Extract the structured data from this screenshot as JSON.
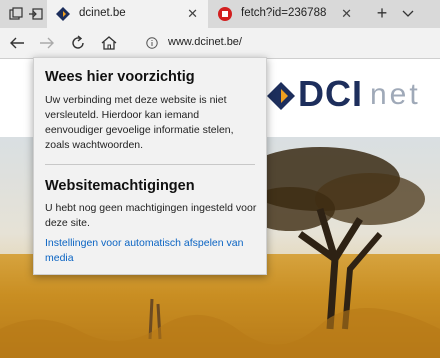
{
  "tabs": [
    {
      "title": "dcinet.be",
      "close_icon": "close-icon"
    },
    {
      "title": "fetch?id=236788",
      "close_icon": "close-icon"
    }
  ],
  "tabbar": {
    "new_tab_label": "+"
  },
  "address": {
    "url": "www.dcinet.be/"
  },
  "site": {
    "logo_main": "DCI",
    "logo_suffix": "net"
  },
  "flyout": {
    "heading1": "Wees hier voorzichtig",
    "text1": "Uw verbinding met deze website is niet versleuteld. Hierdoor kan iemand eenvoudiger gevoelige informatie stelen, zoals wachtwoorden.",
    "heading2": "Websitemachtigingen",
    "text2": "U hebt nog geen machtigingen ingesteld voor deze site.",
    "link": "Instellingen voor automatisch afspelen van media"
  },
  "colors": {
    "link": "#0b64c3",
    "logo_navy": "#1d2e5c",
    "logo_orange": "#f0a020",
    "field": "#c98e22"
  }
}
